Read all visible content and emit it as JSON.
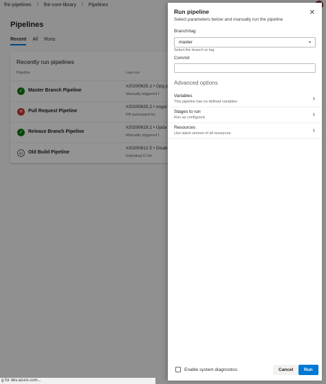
{
  "breadcrumb": [
    "fhir-pipelines",
    "fhir-core-library",
    "Pipelines"
  ],
  "breadcrumb_sep": "/",
  "page_title": "Pipelines",
  "tabs": [
    "Recent",
    "All",
    "Runs"
  ],
  "card": {
    "title": "Recently run pipelines",
    "col_pipeline": "Pipeline",
    "col_last_run": "Last run",
    "rows": [
      {
        "name": "Master Branch Pipeline",
        "status": "success",
        "status_glyph": "✓",
        "run": "#20200625.1 • Gpg p",
        "sub": "Manually triggered f"
      },
      {
        "name": "Pull Request Pipeline",
        "status": "failed",
        "status_glyph": "✕",
        "run": "#20200625.2 • ongoi",
        "sub": "PR automated for"
      },
      {
        "name": "Release Branch Pipeline",
        "status": "success",
        "status_glyph": "✓",
        "run": "#20200619.1 • Upda",
        "sub": "Manually triggered f"
      },
      {
        "name": "Old Build Pipeline",
        "status": "skipped",
        "status_glyph": "⊘",
        "run": "#20200612.5 • Disab",
        "sub": "Individual CI for"
      }
    ]
  },
  "status_bar": "g for dev.azure.com...",
  "panel": {
    "title": "Run pipeline",
    "close_glyph": "✕",
    "subtitle": "Select parameters below and manually run the pipeline",
    "branch_label": "Branch/tag",
    "branch_value": "master",
    "branch_hint": "Select the branch or tag",
    "commit_label": "Commit",
    "advanced_label": "Advanced options",
    "options": [
      {
        "title": "Variables",
        "sub": "This pipeline has no defined variables"
      },
      {
        "title": "Stages to run",
        "sub": "Run as configured"
      },
      {
        "title": "Resources",
        "sub": "Use latest version of all resources"
      }
    ],
    "diagnostics_label": "Enable system diagnostics",
    "cancel_label": "Cancel",
    "run_label": "Run"
  }
}
